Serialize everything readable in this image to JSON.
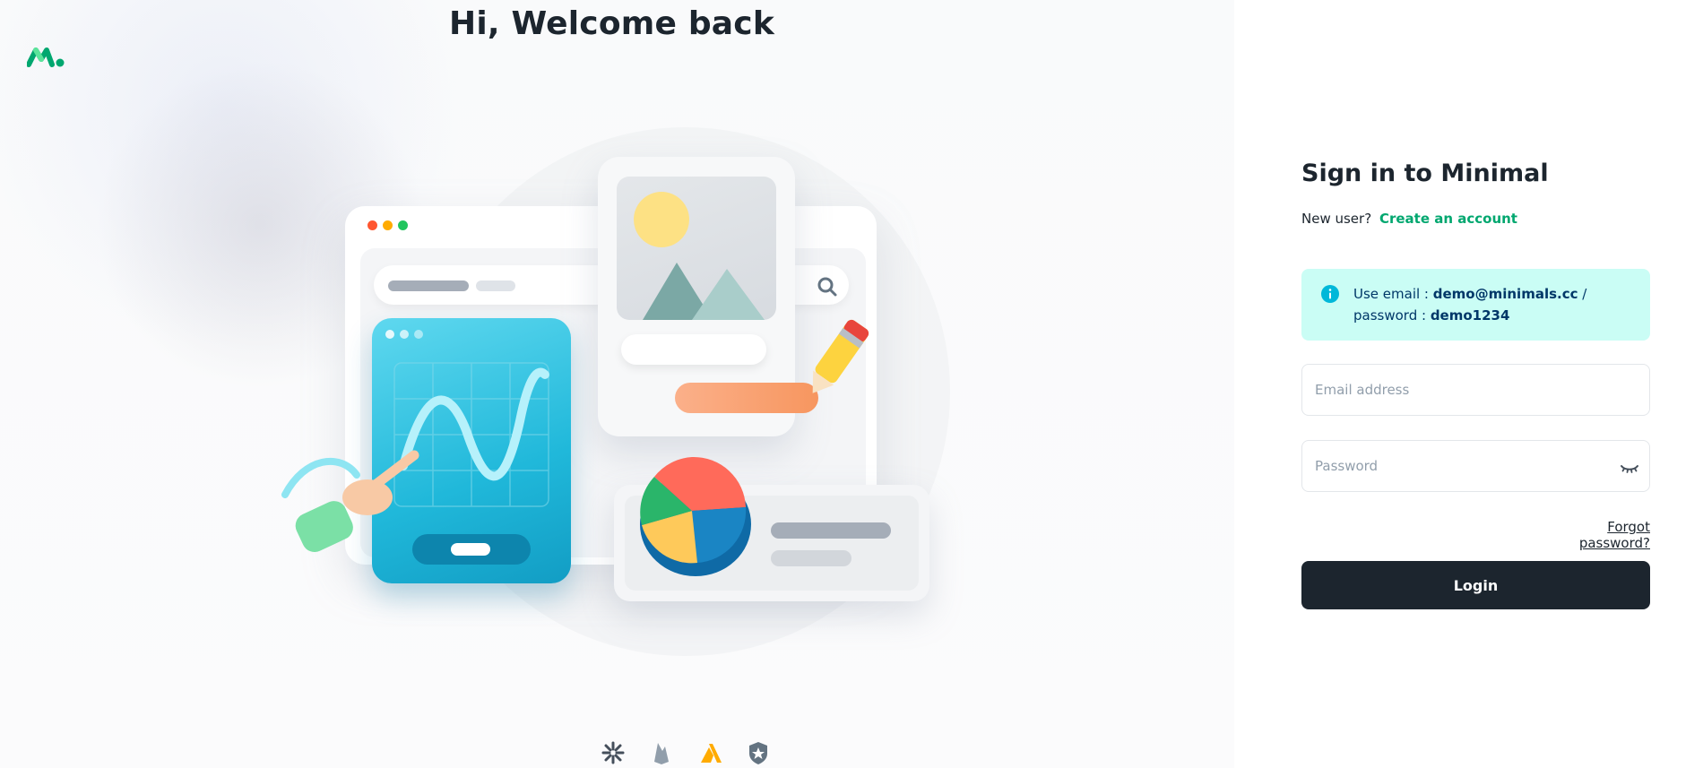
{
  "hero": {
    "title": "Hi, Welcome back",
    "logo_icon": "minimal-logo-icon"
  },
  "colors": {
    "brand_green": "#00a76f",
    "dark": "#1c252e",
    "info_bg": "#cafdf5",
    "info_icon": "#00b8d9",
    "info_text": "#003768",
    "placeholder": "#919eab"
  },
  "brand_icons": [
    "jwt-icon",
    "firebase-icon",
    "amplify-icon",
    "auth0-icon"
  ],
  "signin": {
    "title": "Sign in to Minimal",
    "new_user_prefix": "New user?",
    "create_account": "Create an account"
  },
  "alert": {
    "prefix": "Use email : ",
    "email": "demo@minimals.cc",
    "middle": " / password : ",
    "password": "demo1234",
    "icon": "info-icon"
  },
  "form": {
    "email_placeholder": "Email address",
    "email_value": "",
    "password_placeholder": "Password",
    "password_value": "",
    "password_toggle_icon": "eye-closed-icon",
    "forgot_label": "Forgot password?",
    "login_label": "Login"
  }
}
